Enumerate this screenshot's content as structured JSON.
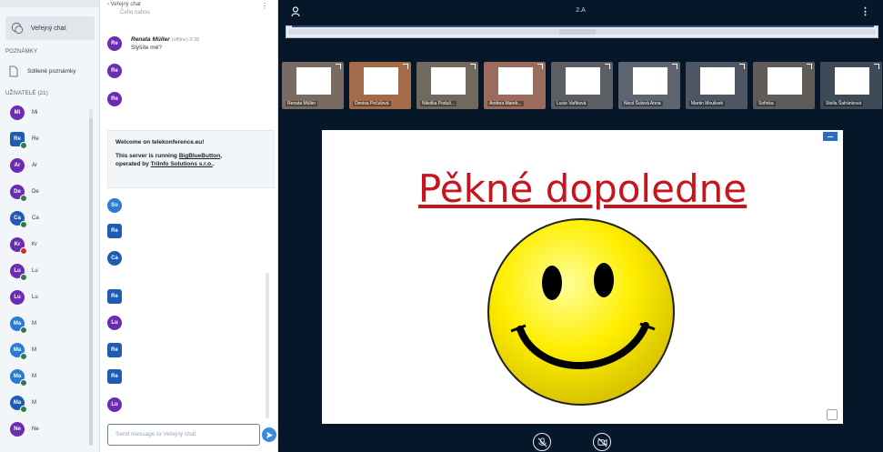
{
  "left_panel": {
    "public_chat_label": "Veřejný chat",
    "notes_section": "POZNÁMKY",
    "shared_notes_label": "Sdílené poznámky",
    "users_section": "UŽIVATELÉ (21)",
    "users": [
      {
        "initials": "Mi",
        "color": "#6a2cb3",
        "square": false,
        "status": "",
        "name": "Mi"
      },
      {
        "initials": "Re",
        "color": "#1e5cb3",
        "square": true,
        "status": "green",
        "name": "Re"
      },
      {
        "initials": "Ar",
        "color": "#6a2cb3",
        "square": false,
        "status": "",
        "name": "Ar"
      },
      {
        "initials": "De",
        "color": "#6a2cb3",
        "square": false,
        "status": "green",
        "name": "De"
      },
      {
        "initials": "Ca",
        "color": "#1e5cb3",
        "square": false,
        "status": "green",
        "name": "Ca"
      },
      {
        "initials": "Kr",
        "color": "#6a2cb3",
        "square": false,
        "status": "red",
        "name": "Kr"
      },
      {
        "initials": "Lu",
        "color": "#6a2cb3",
        "square": false,
        "status": "green",
        "name": "Lu"
      },
      {
        "initials": "Lu",
        "color": "#6a2cb3",
        "square": false,
        "status": "",
        "name": "Lu"
      },
      {
        "initials": "Ma",
        "color": "#2a7bd6",
        "square": false,
        "status": "green",
        "name": "M"
      },
      {
        "initials": "Ma",
        "color": "#2a7bd6",
        "square": false,
        "status": "green",
        "name": "M"
      },
      {
        "initials": "Ma",
        "color": "#2a7bd6",
        "square": false,
        "status": "green",
        "name": "M"
      },
      {
        "initials": "Ma",
        "color": "#1e5cb3",
        "square": false,
        "status": "green",
        "name": "M"
      },
      {
        "initials": "Ne",
        "color": "#6a2cb3",
        "square": false,
        "status": "",
        "name": "Ne"
      }
    ]
  },
  "chat": {
    "header": "Veřejný chat",
    "first_msg_text": "Čeho nahou",
    "renata": {
      "initials": "Re",
      "author": "Renata Müller",
      "meta": "(offline) 9:38",
      "text": "Slyšíte mě?"
    },
    "re_avatars": [
      "Re",
      "Re"
    ],
    "welcome_line1": "Welcome on telekonference.eu!",
    "welcome_line2a": "This server is running ",
    "welcome_link1": "BigBlueButton",
    "welcome_line2b": ",",
    "welcome_line3a": "operated by ",
    "welcome_link2": "TriInfo Solutions s.r.o.",
    "welcome_line3b": ".",
    "later_avatars": [
      {
        "initials": "So",
        "color": "#2a7bd6",
        "square": false
      },
      {
        "initials": "Re",
        "color": "#1e5cb3",
        "square": true
      },
      {
        "initials": "Ca",
        "color": "#1e5cb3",
        "square": false
      },
      {
        "initials": "Re",
        "color": "#1e5cb3",
        "square": true
      },
      {
        "initials": "Lu",
        "color": "#6a2cb3",
        "square": false
      },
      {
        "initials": "Re",
        "color": "#1e5cb3",
        "square": true
      },
      {
        "initials": "Re",
        "color": "#1e5cb3",
        "square": true
      },
      {
        "initials": "Lu",
        "color": "#6a2cb3",
        "square": false
      }
    ],
    "input_placeholder": "Send message to Veřejný chat"
  },
  "main": {
    "title": "2.A",
    "thumbnails": [
      {
        "name": "Renata Müller",
        "bg": "#7a6b62"
      },
      {
        "name": "Denisa Pečulová",
        "bg": "#a36b4a"
      },
      {
        "name": "Nikolka Poduš...",
        "bg": "#6f6a5d"
      },
      {
        "name": "Andrea Marek...",
        "bg": "#9b6c5e"
      },
      {
        "name": "Lucie Vaňková",
        "bg": "#5b5e63"
      },
      {
        "name": "Nicol Šulová Anna",
        "bg": "#5e6570"
      },
      {
        "name": "Martin Moulisek",
        "bg": "#4d5662"
      },
      {
        "name": "Sofinka",
        "bg": "#5f5b58"
      },
      {
        "name": "Stella Šafránková",
        "bg": "#3f4a57"
      }
    ],
    "slide_title": "Pěkné dopoledne"
  }
}
